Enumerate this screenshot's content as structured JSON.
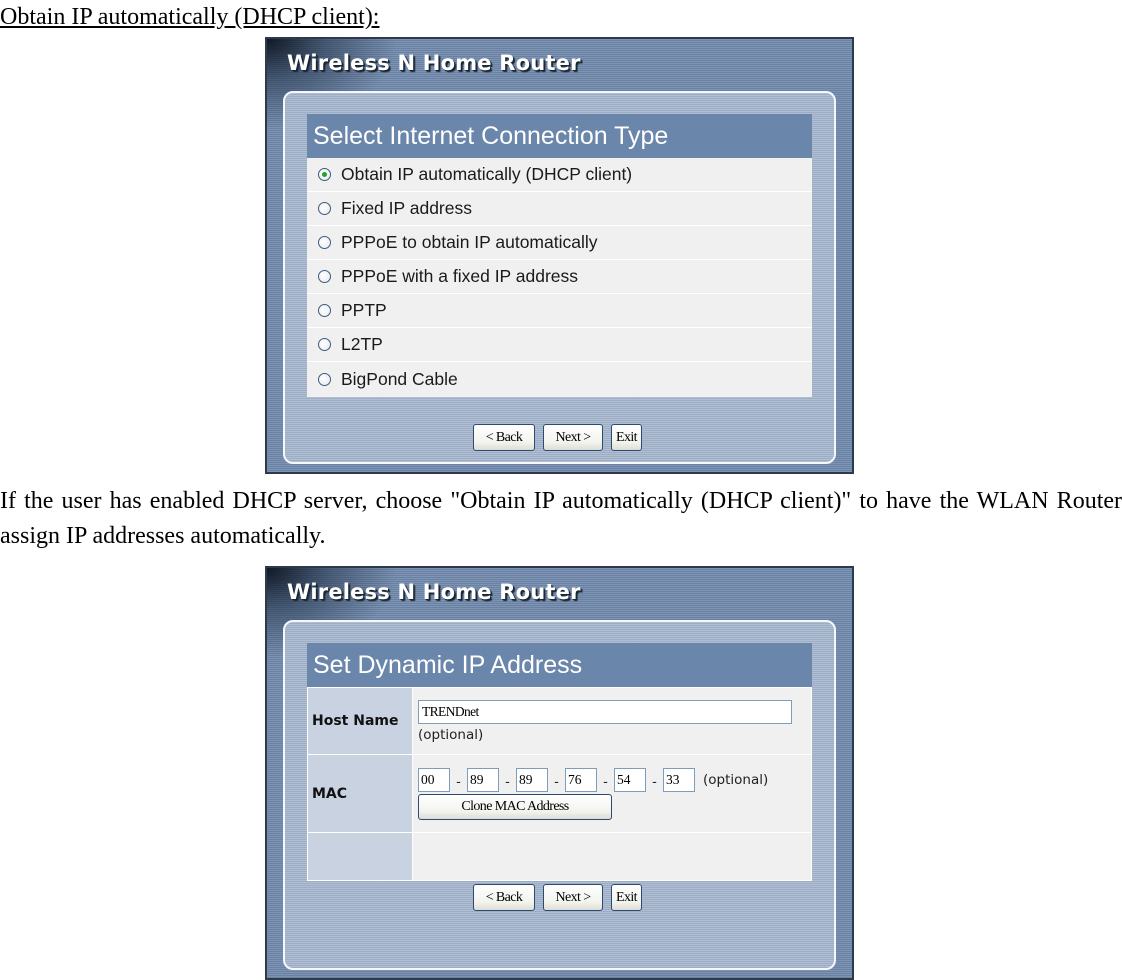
{
  "document": {
    "heading": "Obtain IP automatically (DHCP client):",
    "paragraph": "If the user has enabled DHCP server, choose \"Obtain IP automatically (DHCP client)\" to have the WLAN Router assign IP addresses automatically."
  },
  "panel1": {
    "brand_title": "Wireless N Home Router",
    "section_title": "Select Internet Connection Type",
    "options": [
      {
        "label": "Obtain IP automatically (DHCP client)",
        "checked": true
      },
      {
        "label": "Fixed IP address",
        "checked": false
      },
      {
        "label": "PPPoE to obtain IP automatically",
        "checked": false
      },
      {
        "label": "PPPoE with a fixed IP address",
        "checked": false
      },
      {
        "label": "PPTP",
        "checked": false
      },
      {
        "label": "L2TP",
        "checked": false
      },
      {
        "label": "BigPond Cable",
        "checked": false
      }
    ],
    "buttons": {
      "back": "< Back",
      "next": "Next >",
      "exit": "Exit"
    }
  },
  "panel2": {
    "brand_title": "Wireless N Home Router",
    "section_title": "Set Dynamic IP Address",
    "host_name": {
      "label": "Host Name",
      "value": "TRENDnet",
      "hint": "(optional)"
    },
    "mac": {
      "label": "MAC",
      "octets": [
        "00",
        "89",
        "89",
        "76",
        "54",
        "33"
      ],
      "separator": "-",
      "hint": "(optional)",
      "clone_button": "Clone MAC Address"
    },
    "buttons": {
      "back": "< Back",
      "next": "Next >",
      "exit": "Exit"
    }
  },
  "colors": {
    "panel_bg": "#6f88ab",
    "section_header": "#6a86ab",
    "row_bg": "#f0f0f0",
    "label_cell_bg": "#c9d2e0",
    "radio_checked": "#21a421"
  }
}
